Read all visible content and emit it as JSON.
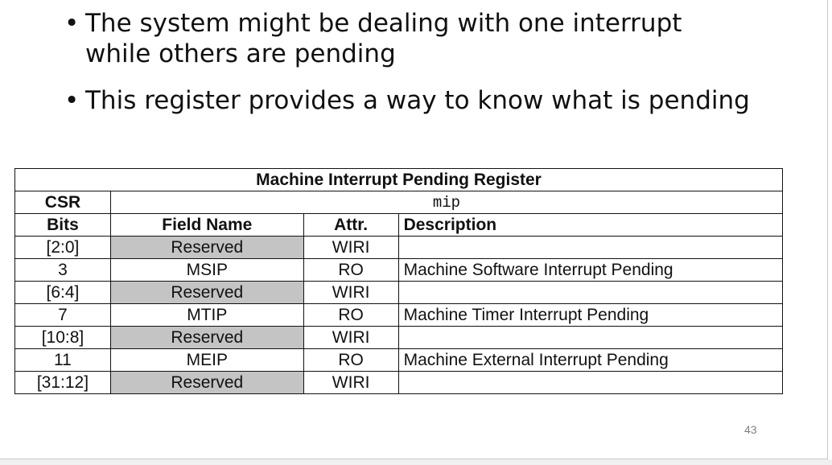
{
  "bullets": [
    "The system might be dealing with one interrupt while others are pending",
    "This register provides a way to know what is pending"
  ],
  "register_table": {
    "title": "Machine Interrupt Pending Register",
    "csr_label": "CSR",
    "csr_value": "mip",
    "headers": {
      "bits": "Bits",
      "field_name": "Field Name",
      "attr": "Attr.",
      "description": "Description"
    },
    "rows": [
      {
        "bits": "[2:0]",
        "field": "Reserved",
        "attr": "WIRI",
        "description": ""
      },
      {
        "bits": "3",
        "field": "MSIP",
        "attr": "RO",
        "description": "Machine Software Interrupt Pending"
      },
      {
        "bits": "[6:4]",
        "field": "Reserved",
        "attr": "WIRI",
        "description": ""
      },
      {
        "bits": "7",
        "field": "MTIP",
        "attr": "RO",
        "description": "Machine Timer Interrupt Pending"
      },
      {
        "bits": "[10:8]",
        "field": "Reserved",
        "attr": "WIRI",
        "description": ""
      },
      {
        "bits": "11",
        "field": "MEIP",
        "attr": "RO",
        "description": "Machine External Interrupt Pending"
      },
      {
        "bits": "[31:12]",
        "field": "Reserved",
        "attr": "WIRI",
        "description": ""
      }
    ],
    "reserved_fill_color": "#c4c4c4"
  },
  "page_number": "43"
}
